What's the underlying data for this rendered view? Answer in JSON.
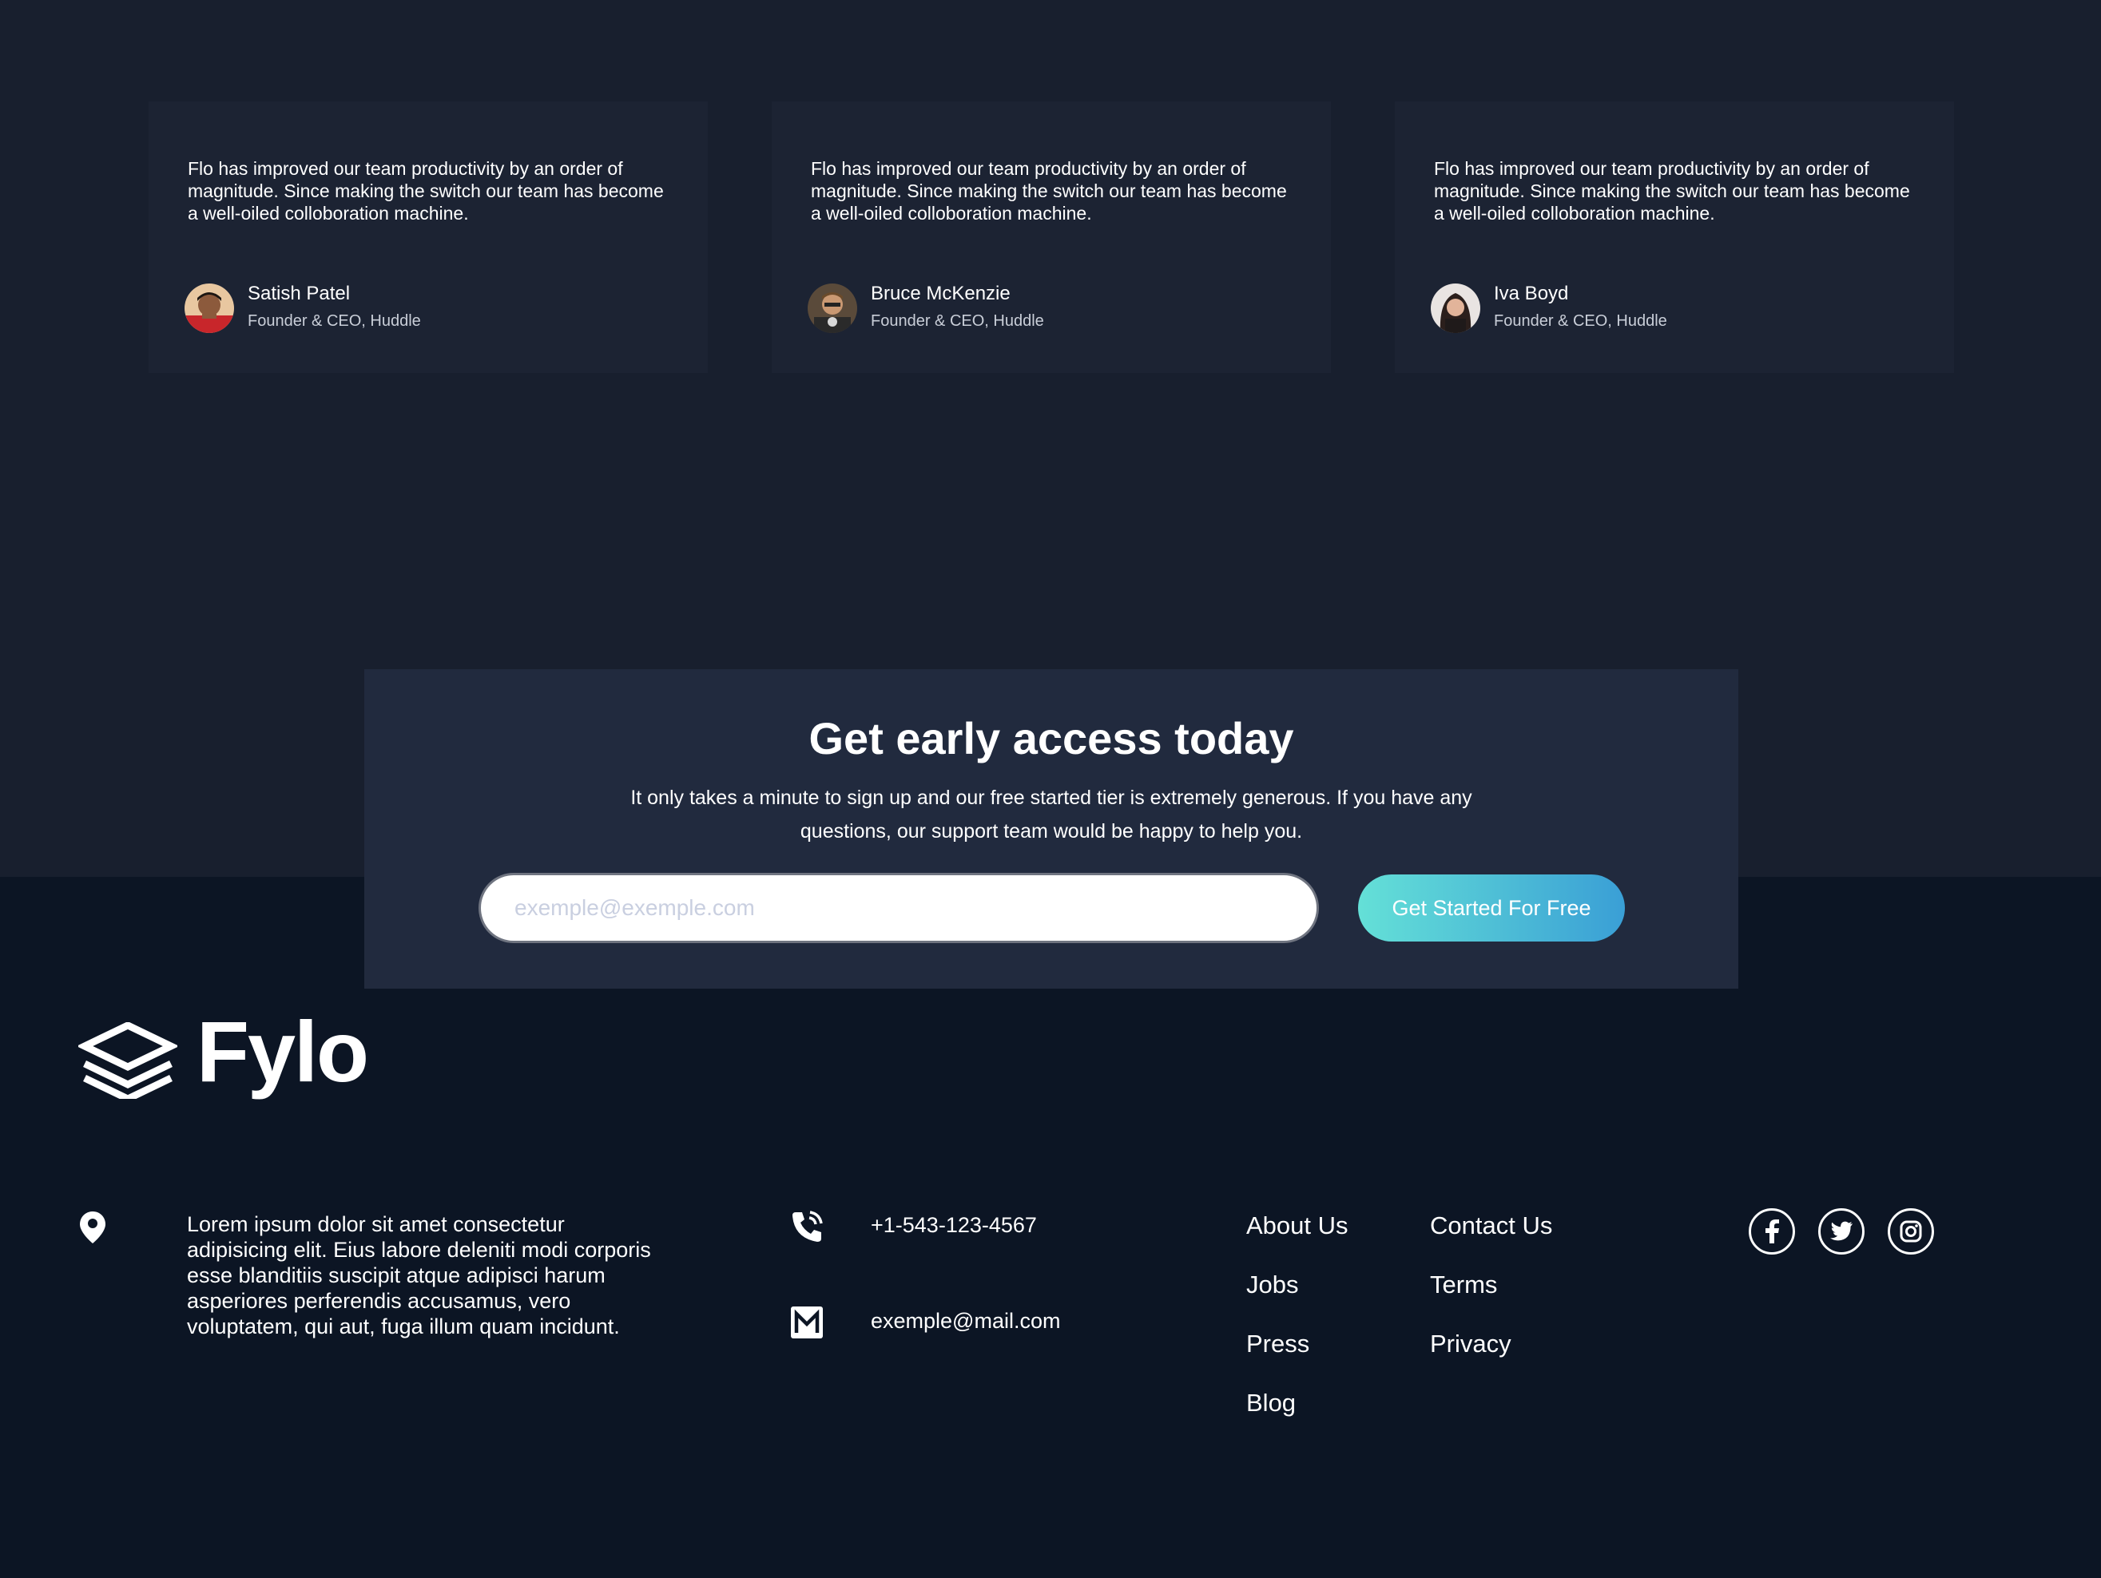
{
  "testimonials": [
    {
      "quote": "Flo has improved our team productivity by an order of magnitude. Since making the switch our team has become a well-oiled colloboration machine.",
      "name": "Satish Patel",
      "role": "Founder & CEO, Huddle"
    },
    {
      "quote": "Flo has improved our team productivity by an order of magnitude. Since making the switch our team has become a well-oiled colloboration machine.",
      "name": "Bruce McKenzie",
      "role": "Founder & CEO, Huddle"
    },
    {
      "quote": "Flo has improved our team productivity by an order of magnitude. Since making the switch our team has become a well-oiled colloboration machine.",
      "name": "Iva Boyd",
      "role": "Founder & CEO, Huddle"
    }
  ],
  "cta": {
    "title": "Get early access today",
    "text": "It only takes a minute to sign up and our free started tier is extremely generous. If you have any questions, our support team would be happy to help you.",
    "email_placeholder": "exemple@exemple.com",
    "email_value": "",
    "button_label": "Get Started For Free"
  },
  "footer": {
    "logo_text": "Fylo",
    "address": "Lorem ipsum dolor sit amet consectetur adipisicing elit. Eius labore deleniti modi corporis esse blanditiis suscipit atque adipisci harum asperiores perferendis accusamus, vero voluptatem, qui aut, fuga illum quam incidunt.",
    "phone": "+1-543-123-4567",
    "email": "exemple@mail.com",
    "links_col1": [
      "About Us",
      "Jobs",
      "Press",
      "Blog"
    ],
    "links_col2": [
      "Contact Us",
      "Terms",
      "Privacy"
    ],
    "social": [
      "facebook-icon",
      "twitter-icon",
      "instagram-icon"
    ]
  },
  "colors": {
    "top_background": "#181f2e",
    "card_background": "#1c2333",
    "cta_background": "#212a3e",
    "footer_background": "#0c1524",
    "button_gradient_start": "#64e0d7",
    "button_gradient_end": "#3a9fd6"
  }
}
